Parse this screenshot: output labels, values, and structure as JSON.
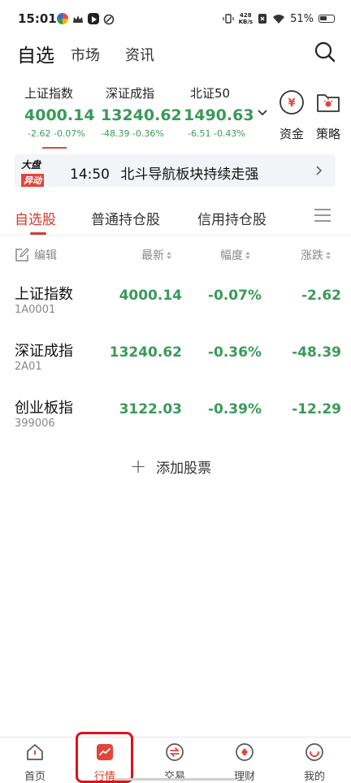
{
  "status_bar": {
    "time": "15:01",
    "net_speed_value": "428",
    "net_speed_unit": "KB/s",
    "battery": "51%"
  },
  "top_nav": {
    "tabs": [
      {
        "label": "自选"
      },
      {
        "label": "市场"
      },
      {
        "label": "资讯"
      }
    ]
  },
  "indexes": [
    {
      "name": "上证指数",
      "price": "4000.14",
      "change": "-2.62",
      "pct": "-0.07%"
    },
    {
      "name": "深证成指",
      "price": "13240.62",
      "change": "-48.39",
      "pct": "-0.36%"
    },
    {
      "name": "北证50",
      "price": "1490.63",
      "change": "-6.51",
      "pct": "-0.43%"
    }
  ],
  "shortcuts": {
    "funds": "资金",
    "strategy": "策略",
    "funds_glyph": "¥"
  },
  "banner": {
    "logo_line1": "大盘",
    "logo_line2": "异动",
    "time": "14:50",
    "text": "北斗导航板块持续走强"
  },
  "sub_tabs": [
    {
      "label": "自选股"
    },
    {
      "label": "普通持仓股"
    },
    {
      "label": "信用持仓股"
    }
  ],
  "columns": {
    "edit": "编辑",
    "latest": "最新",
    "range": "幅度",
    "change": "涨跌"
  },
  "rows": [
    {
      "name": "上证指数",
      "code": "1A0001",
      "latest": "4000.14",
      "range": "-0.07%",
      "change": "-2.62"
    },
    {
      "name": "深证成指",
      "code": "2A01",
      "latest": "13240.62",
      "range": "-0.36%",
      "change": "-48.39"
    },
    {
      "name": "创业板指",
      "code": "399006",
      "latest": "3122.03",
      "range": "-0.39%",
      "change": "-12.29"
    }
  ],
  "add_stock": {
    "label": "添加股票",
    "glyph": "+"
  },
  "bottom_nav": [
    {
      "label": "首页"
    },
    {
      "label": "行情"
    },
    {
      "label": "交易"
    },
    {
      "label": "理财"
    },
    {
      "label": "我的"
    }
  ],
  "colors": {
    "down_green": "#3a9a59",
    "accent_red": "#d9392b",
    "highlight_red": "#e0111a"
  }
}
